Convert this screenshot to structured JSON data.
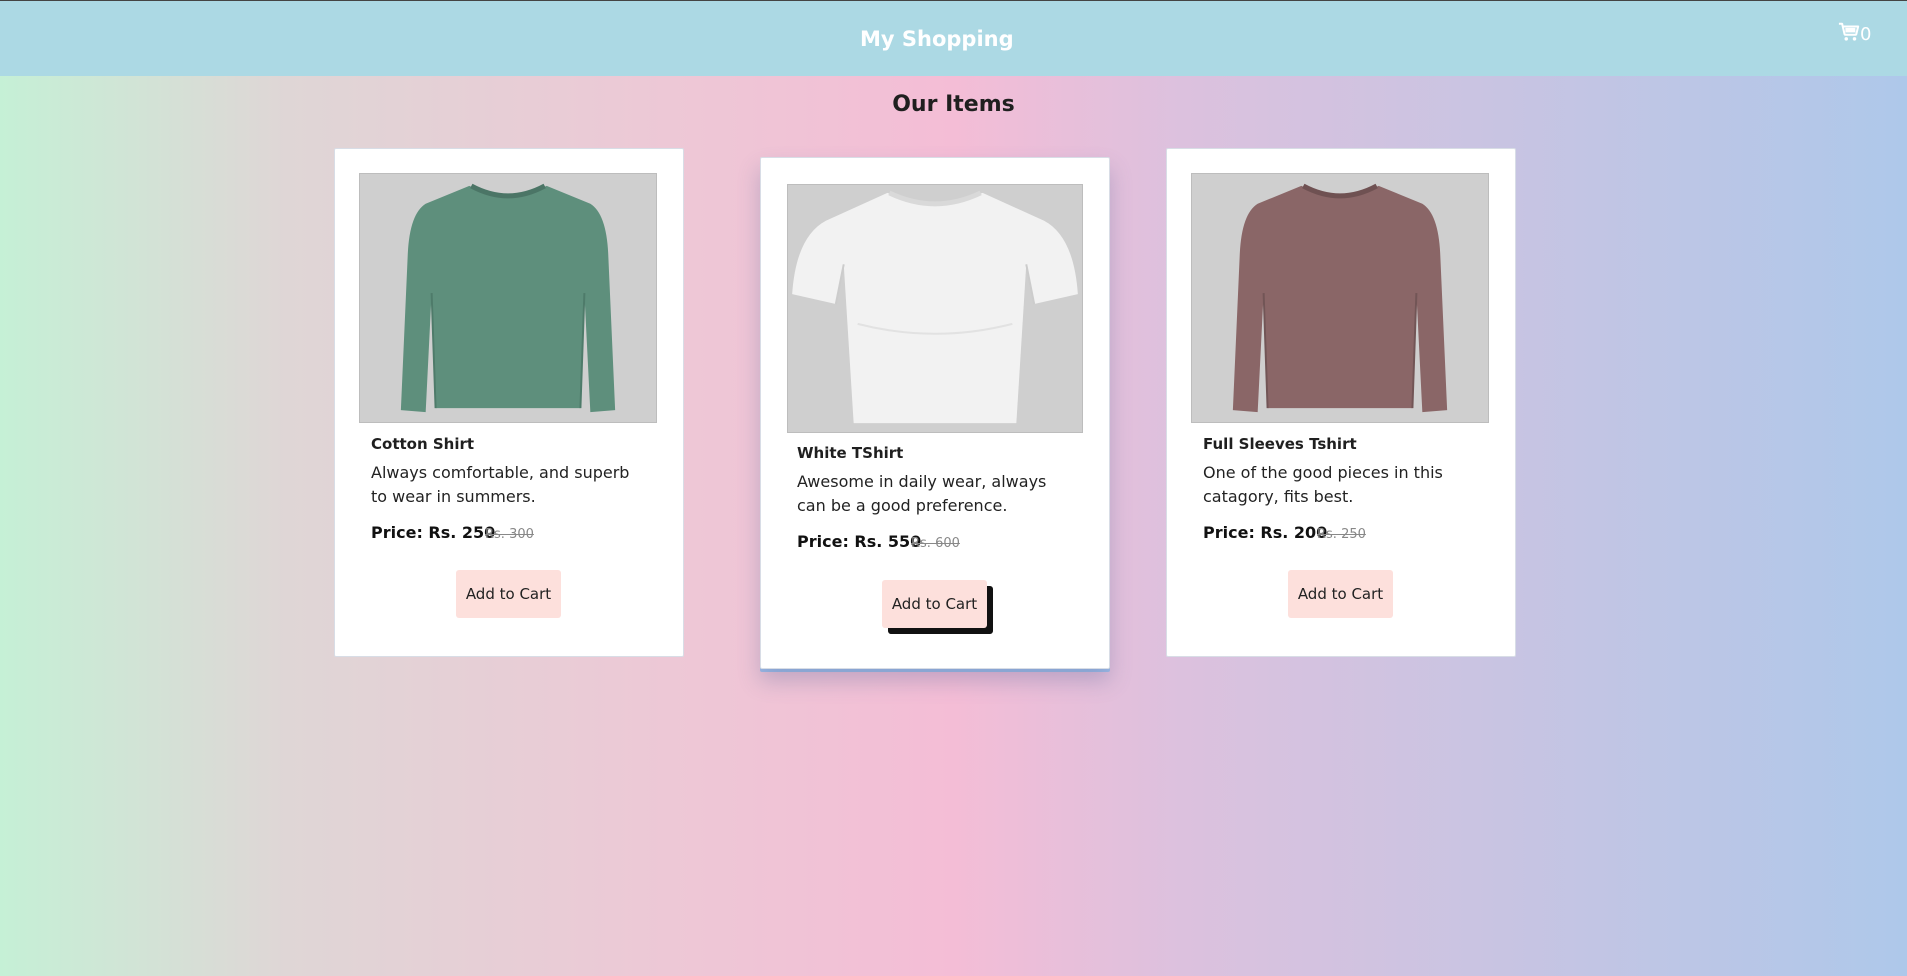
{
  "header": {
    "brand": "My Shopping",
    "cart_icon": "cart-icon",
    "cart_count": "0"
  },
  "main": {
    "heading": "Our Items",
    "products": [
      {
        "name": "Cotton Shirt",
        "description": "Always comfortable, and superb to wear in summers.",
        "price": "Price: Rs. 250",
        "old_price": "Rs. 300",
        "button": "Add to Cart",
        "image": "green-long-sleeve-shirt",
        "color": "#5e8f7c"
      },
      {
        "name": "White TShirt",
        "description": "Awesome in daily wear, always can be a good preference.",
        "price": "Price: Rs. 550",
        "old_price": "Rs. 600",
        "button": "Add to Cart",
        "image": "white-tshirt",
        "color": "#f2f2f2"
      },
      {
        "name": "Full Sleeves Tshirt",
        "description": "One of the good pieces in this catagory, fits best.",
        "price": "Price: Rs. 200",
        "old_price": "Rs. 250",
        "button": "Add to Cart",
        "image": "maroon-long-sleeve-shirt",
        "color": "#8a6667"
      }
    ]
  },
  "colors": {
    "header_bg": "#acd9e4",
    "button_bg": "#fde0dc"
  }
}
